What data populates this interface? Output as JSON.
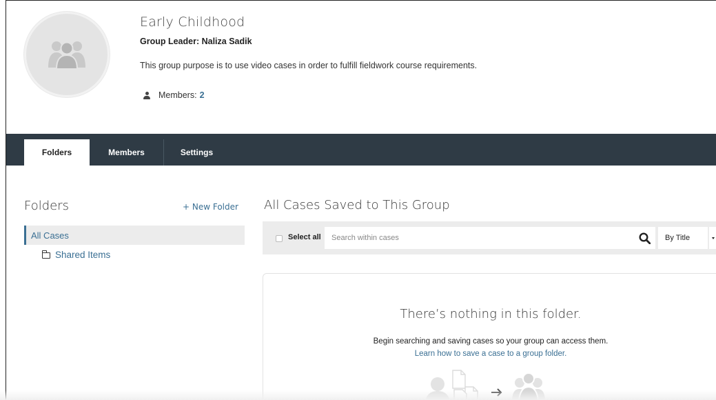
{
  "group": {
    "title": "Early Childhood",
    "leader": "Group Leader: Naliza Sadik",
    "purpose": "This group purpose is to use video cases in order to fulfill fieldwork course requirements.",
    "members_label": "Members:",
    "members_count": "2",
    "avatar_icon": "group-people-icon"
  },
  "tabs": [
    {
      "label": "Folders",
      "active": true
    },
    {
      "label": "Members",
      "active": false
    },
    {
      "label": "Settings",
      "active": false
    }
  ],
  "sidebar": {
    "heading": "Folders",
    "new_folder_label": "+ New Folder",
    "items": [
      {
        "label": "All Cases",
        "selected": true
      },
      {
        "label": "Shared Items",
        "icon": "folder-icon"
      }
    ]
  },
  "main": {
    "heading": "All Cases Saved to This Group",
    "select_all_label": "Select all",
    "search_placeholder": "Search within cases",
    "sort_value": "By Title",
    "empty_title": "There’s nothing in this folder.",
    "empty_message": "Begin searching and saving cases so your group can access them.",
    "empty_link": "Learn how to save a case to a group folder."
  },
  "colors": {
    "tabbar_bg": "#2f3b45",
    "link": "#3a6f93",
    "toolbar_bg": "#ececec"
  }
}
